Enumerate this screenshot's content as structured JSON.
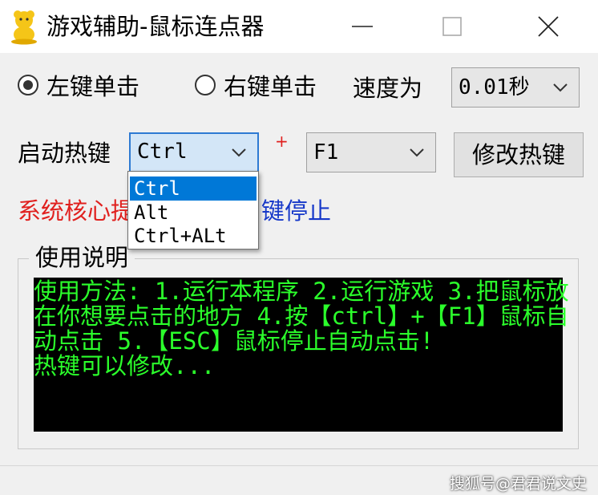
{
  "window": {
    "title": "游戏辅助-鼠标连点器",
    "icon": "yellow-character-icon"
  },
  "options": {
    "left_click_label": "左键单击",
    "right_click_label": "右键单击",
    "selected": "left",
    "speed_label": "速度为",
    "speed_value": "0.01秒"
  },
  "hotkey": {
    "label": "启动热键",
    "modifier_value": "Ctrl",
    "plus": "+",
    "key_value": "F1",
    "modify_button": "修改热键",
    "modifier_options": [
      "Ctrl",
      "Alt",
      "Ctrl+ALt"
    ]
  },
  "status": {
    "red_text": "系统核心提",
    "blue_text": "键停止"
  },
  "instructions": {
    "title": "使用说明",
    "lines": [
      "使用方法: 1.运行本程序 2.运行游戏 3.把鼠标放",
      "在你想要点击的地方 4.按【ctrl】+【F1】鼠标自",
      "动点击 5.【ESC】鼠标停止自动点击!",
      "热键可以修改..."
    ]
  },
  "watermark": "搜狐号@君君说文史",
  "colors": {
    "console_bg": "#000000",
    "console_text": "#2bff2b",
    "status_red": "#e0201e",
    "status_blue": "#1638c9",
    "selection": "#0078d7"
  }
}
